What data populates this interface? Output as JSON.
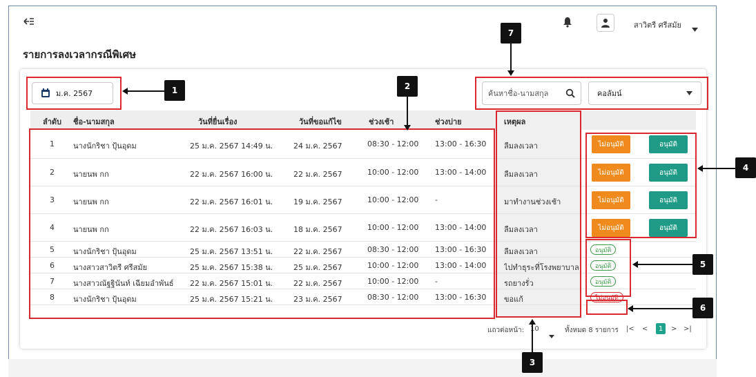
{
  "header": {
    "collapse_icon": "sidebar-collapse-icon",
    "bell_icon": "bell-icon",
    "user_icon": "user-icon",
    "user_name": "สาวิตรี ศรีสมัย",
    "user_caret_icon": "caret-down-icon"
  },
  "page": {
    "title": "รายการลงเวลากรณีพิเศษ"
  },
  "filters": {
    "month_icon": "calendar-icon",
    "month_value": "ม.ค. 2567",
    "search_placeholder": "ค้นหาชื่อ-นามสกุล",
    "search_icon": "search-icon",
    "column_select": "คอลัมน์",
    "column_caret_icon": "caret-down-icon"
  },
  "table": {
    "columns": [
      "ลำดับ",
      "ชื่อ-นามสกุล",
      "วันที่ยื่นเรื่อง",
      "วันที่ขอแก้ไข",
      "ช่วงเช้า",
      "ช่วงบ่าย",
      "เหตุผล"
    ],
    "rows": [
      {
        "no": "1",
        "name": "นางนักริชา ปุ้นอุดม",
        "submitted": "25 ม.ค. 2567 14:49 น.",
        "edit_date": "24 ม.ค. 2567",
        "morning": "08:30 - 12:00",
        "afternoon": "13:00 - 16:30",
        "reason": "ลืมลงเวลา",
        "state": "pending"
      },
      {
        "no": "2",
        "name": "นายนพ กก",
        "submitted": "22 ม.ค. 2567 16:00 น.",
        "edit_date": "22 ม.ค. 2567",
        "morning": "10:00 - 12:00",
        "afternoon": "13:00 - 14:00",
        "reason": "ลืมลงเวลา",
        "state": "pending"
      },
      {
        "no": "3",
        "name": "นายนพ กก",
        "submitted": "22 ม.ค. 2567 16:01 น.",
        "edit_date": "19 ม.ค. 2567",
        "morning": "10:00 - 12:00",
        "afternoon": "-",
        "reason": "มาทำงานช่วงเช้า",
        "state": "pending"
      },
      {
        "no": "4",
        "name": "นายนพ กก",
        "submitted": "22 ม.ค. 2567 16:03 น.",
        "edit_date": "18 ม.ค. 2567",
        "morning": "10:00 - 12:00",
        "afternoon": "13:00 - 14:00",
        "reason": "ลืมลงเวลา",
        "state": "pending"
      },
      {
        "no": "5",
        "name": "นางนักริชา ปุ้นอุดม",
        "submitted": "25 ม.ค. 2567 13:51 น.",
        "edit_date": "22 ม.ค. 2567",
        "morning": "08:30 - 12:00",
        "afternoon": "13:00 - 16:30",
        "reason": "ลืมลงเวลา",
        "state": "approved"
      },
      {
        "no": "6",
        "name": "นางสาวสาวิตรี ศรีสมัย",
        "submitted": "25 ม.ค. 2567 15:38 น.",
        "edit_date": "25 ม.ค. 2567",
        "morning": "10:00 - 12:00",
        "afternoon": "13:00 - 14:00",
        "reason": "ไปทำธุระที่โรงพยาบาล",
        "state": "approved"
      },
      {
        "no": "7",
        "name": "นางสาวณัฐฐินันท์ เฉียมอำพันธ์",
        "submitted": "22 ม.ค. 2567 15:01 น.",
        "edit_date": "22 ม.ค. 2567",
        "morning": "10:00 - 12:00",
        "afternoon": "-",
        "reason": "รถยางรั่ว",
        "state": "approved"
      },
      {
        "no": "8",
        "name": "นางนักริชา ปุ้นอุดม",
        "submitted": "25 ม.ค. 2567 15:21 น.",
        "edit_date": "23 ม.ค. 2567",
        "morning": "08:30 - 12:00",
        "afternoon": "13:00 - 16:30",
        "reason": "ขอแก้",
        "state": "rejected"
      }
    ],
    "labels": {
      "reject": "ไม่อนุมัติ",
      "approve": "อนุมัติ"
    }
  },
  "pagination": {
    "rows_per_page_label": "แถวต่อหน้า:",
    "rows_per_page_value": "10",
    "total_label": "ทั้งหมด 8 รายการ",
    "first_icon": "|<",
    "prev_icon": "<",
    "current_page": "1",
    "next_icon": ">",
    "last_icon": ">|"
  },
  "callouts": [
    "1",
    "2",
    "3",
    "4",
    "5",
    "6",
    "7"
  ],
  "colors": {
    "reject": "#f08a1c",
    "approve": "#1e9a86",
    "highlight": "#d8282d",
    "page_active": "#1fa38d"
  }
}
